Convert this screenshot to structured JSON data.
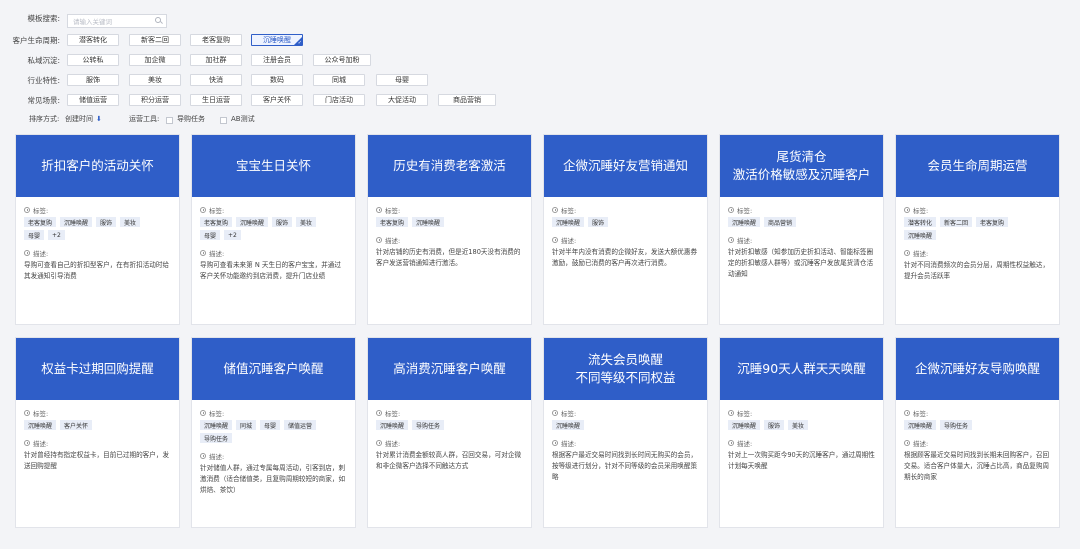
{
  "filters": {
    "search_label": "模板搜索:",
    "search_placeholder": "请输入关键词",
    "lifecycle": {
      "label": "客户生命周期:",
      "options": [
        "潜客转化",
        "新客二回",
        "老客复购",
        "沉睡唤醒"
      ],
      "selected": "沉睡唤醒"
    },
    "private": {
      "label": "私域沉淀:",
      "options": [
        "公转私",
        "加企微",
        "加社群",
        "注册会员",
        "公众号加粉"
      ]
    },
    "industry": {
      "label": "行业特性:",
      "options": [
        "服饰",
        "美妆",
        "快消",
        "数码",
        "同城",
        "母婴"
      ]
    },
    "scene": {
      "label": "常见场景:",
      "options": [
        "储值运营",
        "积分运营",
        "生日运营",
        "客户关怀",
        "门店活动",
        "大促活动",
        "商品营销"
      ]
    },
    "sort_label": "排序方式:",
    "sort_value": "创建时间",
    "tools_label": "运营工具:",
    "tool1": "导购任务",
    "tool2": "AB测试"
  },
  "card_labels": {
    "tags": "标签:",
    "desc": "描述:"
  },
  "cards": [
    {
      "title": "折扣客户的活动关怀",
      "tags": [
        "老客复购",
        "沉睡唤醒",
        "服饰",
        "美妆",
        "母婴",
        "+2"
      ],
      "desc": "导购可查看自己的折扣型客户，在有折扣活动时给其发通知引导消费"
    },
    {
      "title": "宝宝生日关怀",
      "tags": [
        "老客复购",
        "沉睡唤醒",
        "服饰",
        "美妆",
        "母婴",
        "+2"
      ],
      "desc": "导购可查看未来第 N 天生日的客户宝宝，并通过客户关怀功能邀约到店消费，提升门店业绩"
    },
    {
      "title": "历史有消费老客激活",
      "tags": [
        "老客复购",
        "沉睡唤醒"
      ],
      "desc": "针对店铺的历史有消费，但是近180天没有消费的客户发送营销通知进行激活。"
    },
    {
      "title": "企微沉睡好友营销通知",
      "tags": [
        "沉睡唤醒",
        "服饰"
      ],
      "desc": "针对半年内没有消费的企微好友，发送大额优惠券激励，鼓励已消费的客户再次进行消费。"
    },
    {
      "title": "尾货清仓\n激活价格敏感及沉睡客户",
      "tags": [
        "沉睡唤醒",
        "商品营销"
      ],
      "desc": "针对折扣敏感（知参加历史折扣活动、智能标签圈定的折扣敏感人群等）或沉睡客户发放尾货清仓活动通知"
    },
    {
      "title": "会员生命周期运营",
      "tags": [
        "潜客转化",
        "新客二回",
        "老客复购",
        "沉睡唤醒"
      ],
      "desc": "针对不同消费频次的会员分层，周期性权益触达，提升会员活跃率"
    },
    {
      "title": "权益卡过期回购提醒",
      "tags": [
        "沉睡唤醒",
        "客户关怀"
      ],
      "desc": "针对曾经持有指定权益卡，目前已过期的客户，发送回购提醒"
    },
    {
      "title": "储值沉睡客户唤醒",
      "tags": [
        "沉睡唤醒",
        "同城",
        "母婴",
        "储值运营",
        "导购任务"
      ],
      "desc": "针对储值人群，通过专属每周活动，引客到店，刺激消费（适合储值类，且复购周期较短的商家，如烘焙、茶饮）"
    },
    {
      "title": "高消费沉睡客户唤醒",
      "tags": [
        "沉睡唤醒",
        "导购任务"
      ],
      "desc": "针对累计消费金额较高人群，召回交易，可对企微和非企微客户选择不同触达方式"
    },
    {
      "title": "流失会员唤醒\n不同等级不同权益",
      "tags": [
        "沉睡唤醒"
      ],
      "desc": "根据客户最近交易时间找到长时间无购买的会员，按等级进行划分，针对不同等级的会员采用唤醒策略"
    },
    {
      "title": "沉睡90天人群天天唤醒",
      "tags": [
        "沉睡唤醒",
        "服饰",
        "美妆"
      ],
      "desc": "针对上一次购买距今90天的沉睡客户，通过周期性计划每天唤醒"
    },
    {
      "title": "企微沉睡好友导购唤醒",
      "tags": [
        "沉睡唤醒",
        "导购任务"
      ],
      "desc": "根据顾客最近交易时间找到长期未回购客户，召回交易。适合客户体量大，沉睡占比高，商品复购周期长的商家"
    }
  ],
  "colors": {
    "accent": "#2f5ec8",
    "tag_bg": "#e8edf7"
  }
}
